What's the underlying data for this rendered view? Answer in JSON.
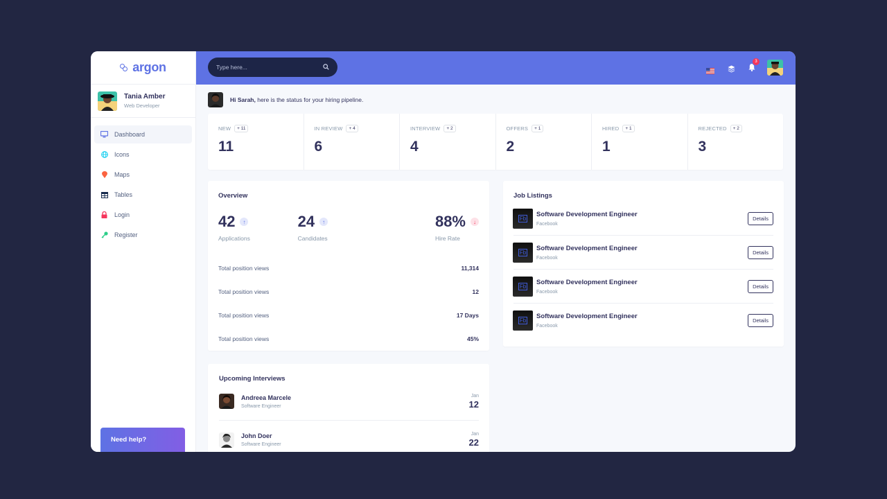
{
  "brand": {
    "name": "argon",
    "accent": "#5e72e4"
  },
  "user": {
    "name": "Tania Amber",
    "role": "Web Developer"
  },
  "sidebar": {
    "items": [
      {
        "label": "Dashboard",
        "icon": "monitor-icon",
        "color": "#5e72e4",
        "active": true
      },
      {
        "label": "Icons",
        "icon": "globe-icon",
        "color": "#11cdef"
      },
      {
        "label": "Maps",
        "icon": "map-pin-icon",
        "color": "#fb6340"
      },
      {
        "label": "Tables",
        "icon": "table-icon",
        "color": "#172b4d"
      },
      {
        "label": "Login",
        "icon": "lock-icon",
        "color": "#f5365c"
      },
      {
        "label": "Register",
        "icon": "key-icon",
        "color": "#2dce89"
      }
    ],
    "help": "Need help?"
  },
  "topbar": {
    "search_placeholder": "Type here...",
    "notification_count": "3",
    "icons": [
      "us-flag-icon",
      "layers-icon",
      "bell-icon",
      "search-icon"
    ]
  },
  "greeting": {
    "name": "Hi Sarah,",
    "message": " here is the status for your hiring pipeline."
  },
  "stats": [
    {
      "label": "NEW",
      "delta": "+ 11",
      "value": "11"
    },
    {
      "label": "IN REVIEW",
      "delta": "+ 4",
      "value": "6"
    },
    {
      "label": "INTERVIEW",
      "delta": "+ 2",
      "value": "4"
    },
    {
      "label": "OFFERS",
      "delta": "+ 1",
      "value": "2"
    },
    {
      "label": "HIRED",
      "delta": "+ 1",
      "value": "1"
    },
    {
      "label": "REJECTED",
      "delta": "+ 2",
      "value": "3"
    }
  ],
  "overview": {
    "title": "Overview",
    "kpis": [
      {
        "value": "42",
        "label": "Applications",
        "trend": "up"
      },
      {
        "value": "24",
        "label": "Candidates",
        "trend": "up"
      },
      {
        "value": "88%",
        "label": "Hire Rate",
        "trend": "down"
      }
    ],
    "rows": [
      {
        "label": "Total position views",
        "value": "11,314"
      },
      {
        "label": "Total position views",
        "value": "12"
      },
      {
        "label": "Total position views",
        "value": "17 Days"
      },
      {
        "label": "Total position views",
        "value": "45%"
      }
    ]
  },
  "jobs": {
    "title": "Job Listings",
    "button": "Details",
    "items": [
      {
        "title": "Software Development Engineer",
        "company": "Facebook",
        "logo": "Fb"
      },
      {
        "title": "Software Development Engineer",
        "company": "Facebook",
        "logo": "Fb"
      },
      {
        "title": "Software Development Engineer",
        "company": "Facebook",
        "logo": "Fb"
      },
      {
        "title": "Software Development Engineer",
        "company": "Facebook",
        "logo": "Fb"
      }
    ]
  },
  "interviews": {
    "title": "Upcoming Interviews",
    "items": [
      {
        "name": "Andreea Marcele",
        "role": "Software Engineer",
        "month": "Jan",
        "day": "12"
      },
      {
        "name": "John Doer",
        "role": "Software Engineer",
        "month": "Jan",
        "day": "22"
      }
    ]
  }
}
